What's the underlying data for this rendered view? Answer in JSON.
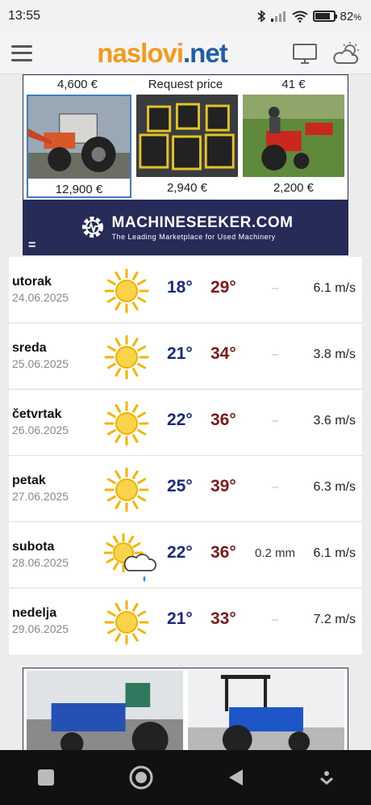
{
  "status_bar": {
    "time": "13:55",
    "battery_percent": "82",
    "battery_level": 0.82
  },
  "header": {
    "logo_part1": "naslovi",
    "logo_part2": ".net"
  },
  "ad_top": {
    "prices_top": [
      "4,600 €",
      "Request price",
      "41 €"
    ],
    "items": [
      {
        "price": "12,900 €",
        "selected": true
      },
      {
        "price": "2,940 €",
        "selected": false
      },
      {
        "price": "2,200 €",
        "selected": false
      }
    ],
    "brand": "MACHINESEEKER.COM",
    "tagline": "The Leading Marketplace for Used Machinery",
    "menu_symbol": "="
  },
  "forecast": [
    {
      "day": "utorak",
      "date": "24.06.2025",
      "icon": "sun-icon",
      "tmin": "18°",
      "tmax": "29°",
      "rain": "–",
      "wind": "6.1 m/s"
    },
    {
      "day": "sreda",
      "date": "25.06.2025",
      "icon": "sun-icon",
      "tmin": "21°",
      "tmax": "34°",
      "rain": "–",
      "wind": "3.8 m/s"
    },
    {
      "day": "četvrtak",
      "date": "26.06.2025",
      "icon": "sun-icon",
      "tmin": "22°",
      "tmax": "36°",
      "rain": "–",
      "wind": "3.6 m/s"
    },
    {
      "day": "petak",
      "date": "27.06.2025",
      "icon": "sun-icon",
      "tmin": "25°",
      "tmax": "39°",
      "rain": "–",
      "wind": "6.3 m/s"
    },
    {
      "day": "subota",
      "date": "28.06.2025",
      "icon": "sun-cloud-rain-icon",
      "tmin": "22°",
      "tmax": "36°",
      "rain": "0.2 mm",
      "wind": "6.1 m/s"
    },
    {
      "day": "nedelja",
      "date": "29.06.2025",
      "icon": "sun-icon",
      "tmin": "21°",
      "tmax": "33°",
      "rain": "–",
      "wind": "7.2 m/s"
    }
  ],
  "colors": {
    "tmin": "#1a2a7a",
    "tmax": "#7a1a1a",
    "logo_orange": "#f39a1e",
    "logo_blue": "#1f5fa6",
    "ad_banner": "#272b57"
  }
}
